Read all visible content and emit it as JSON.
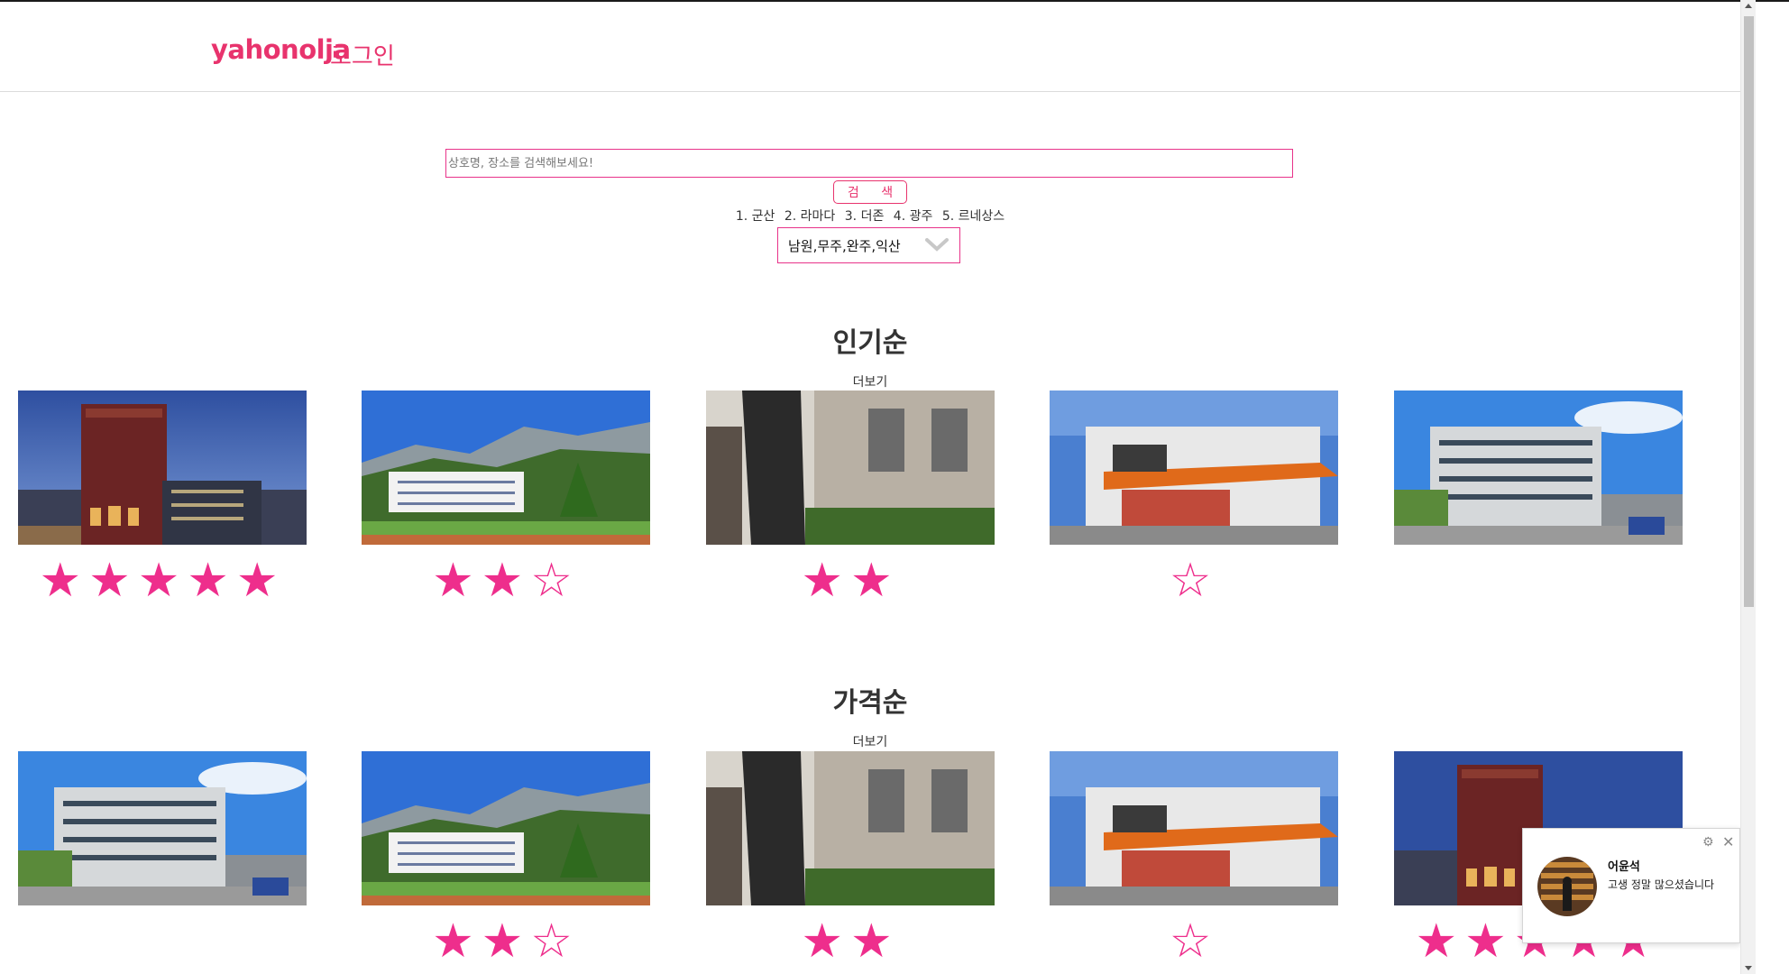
{
  "header": {
    "logo": "yahonolja",
    "login": "로그인"
  },
  "search": {
    "placeholder": "상호명, 장소를 검색해보세요!",
    "button_label": "검 색"
  },
  "top_keywords": [
    "1. 군산",
    "2. 라마다",
    "3. 더존",
    "4. 광주",
    "5. 르네상스"
  ],
  "region_select": {
    "selected": "남원,무주,완주,익산"
  },
  "sections": [
    {
      "title": "인기순",
      "more_label": "더보기",
      "cards": [
        {
          "image": "night-hotel-icon",
          "stars": "★★★★★"
        },
        {
          "image": "mountain-hotel-icon",
          "stars": "★★☆"
        },
        {
          "image": "river-hotel-icon",
          "stars": "★★"
        },
        {
          "image": "motel-building-icon",
          "stars": "☆"
        },
        {
          "image": "yeosu-hotel-icon",
          "stars": ""
        }
      ]
    },
    {
      "title": "가격순",
      "more_label": "더보기",
      "cards": [
        {
          "image": "yeosu-hotel-icon",
          "stars": ""
        },
        {
          "image": "mountain-hotel-icon",
          "stars": "★★☆"
        },
        {
          "image": "river-hotel-icon",
          "stars": "★★"
        },
        {
          "image": "motel-building-icon",
          "stars": "☆"
        },
        {
          "image": "night-hotel-icon",
          "stars": "★★★★★"
        }
      ]
    }
  ],
  "chat_toast": {
    "name": "어윤석",
    "message": "고생 정말 많으셨습니다"
  },
  "colors": {
    "brand": "#e8336d",
    "star": "#ee2e8c",
    "border": "#e8338a"
  }
}
